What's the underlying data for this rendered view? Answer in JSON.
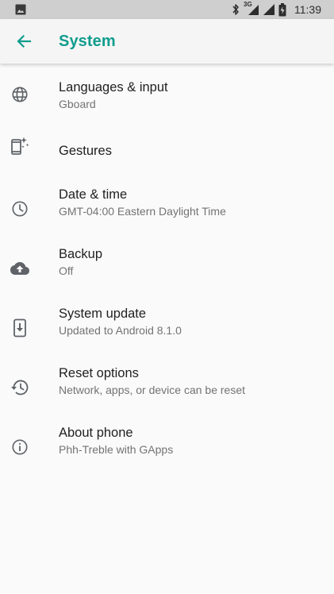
{
  "status_bar": {
    "network_label": "3G",
    "time": "11:39",
    "icons": [
      "image-notification-icon",
      "bluetooth-icon",
      "cell-signal-icon",
      "wifi-signal-icon",
      "battery-icon"
    ]
  },
  "app_bar": {
    "title": "System",
    "back_icon": "back-arrow-icon",
    "accent_color": "#0f9d8e"
  },
  "items": [
    {
      "title": "Languages & input",
      "subtitle": "Gboard",
      "icon": "globe-icon"
    },
    {
      "title": "Gestures",
      "subtitle": "",
      "icon": "gestures-icon"
    },
    {
      "title": "Date & time",
      "subtitle": "GMT-04:00 Eastern Daylight Time",
      "icon": "clock-icon"
    },
    {
      "title": "Backup",
      "subtitle": "Off",
      "icon": "cloud-upload-icon"
    },
    {
      "title": "System update",
      "subtitle": "Updated to Android 8.1.0",
      "icon": "system-update-icon"
    },
    {
      "title": "Reset options",
      "subtitle": "Network, apps, or device can be reset",
      "icon": "restore-icon"
    },
    {
      "title": "About phone",
      "subtitle": "Phh-Treble with GApps",
      "icon": "info-icon"
    }
  ]
}
